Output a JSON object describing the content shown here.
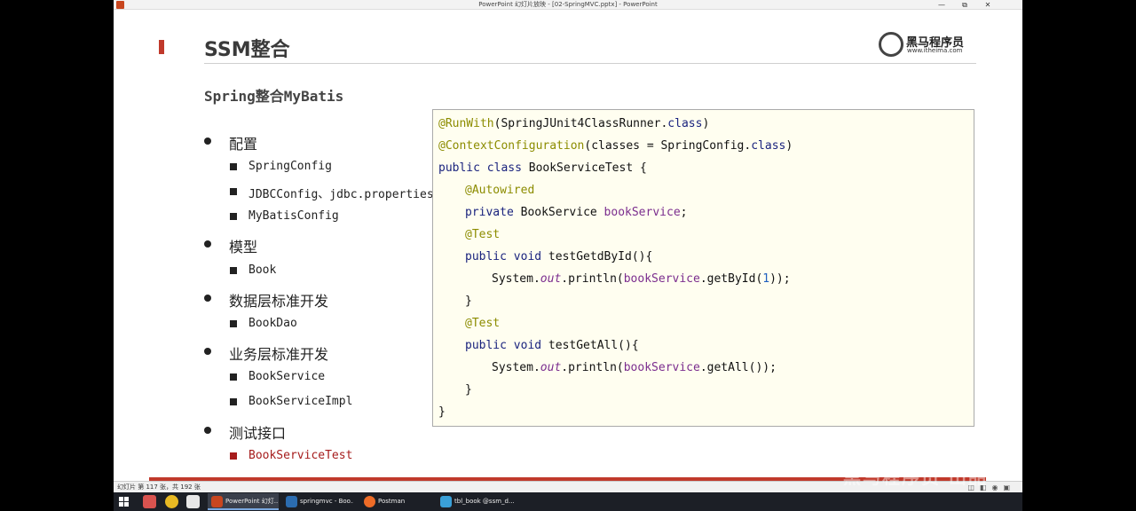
{
  "window": {
    "title": "PowerPoint 幻灯片放映 - [02-SpringMVC.pptx] - PowerPoint",
    "min_label": "—",
    "max_label": "⧉",
    "close_label": "✕"
  },
  "slide": {
    "title": "SSM整合",
    "logo": {
      "brand": "黑马程序员",
      "url": "www.itheima.com"
    },
    "subtitle": "Spring整合MyBatis",
    "outline": [
      {
        "label": "配置",
        "children": [
          "SpringConfig",
          "JDBCConfig、jdbc.properties",
          "MyBatisConfig"
        ]
      },
      {
        "label": "模型",
        "children": [
          "Book"
        ]
      },
      {
        "label": "数据层标准开发",
        "children": [
          "BookDao"
        ]
      },
      {
        "label": "业务层标准开发",
        "children": [
          "BookService",
          "BookServiceImpl"
        ]
      },
      {
        "label": "测试接口",
        "children": [
          "BookServiceTest"
        ]
      }
    ],
    "code": {
      "l1_ann": "@RunWith",
      "l1_rest": "(SpringJUnit4ClassRunner.",
      "l1_kw": "class",
      "l1_end": ")",
      "l2_ann": "@ContextConfiguration",
      "l2_rest": "(classes = SpringConfig.",
      "l2_kw": "class",
      "l2_end": ")",
      "l3_kw": "public class",
      "l3_rest": " BookServiceTest {",
      "l4_ann": "@Autowired",
      "l5_kw": "private",
      "l5_rest": " BookService ",
      "l5_fld": "bookService",
      "l5_end": ";",
      "l6_ann": "@Test",
      "l7_kw": "public void",
      "l7_rest": " testGetdById(){",
      "l8_pre": "System.",
      "l8_out": "out",
      "l8_mid": ".println(",
      "l8_fld": "bookService",
      "l8_call": ".getById(",
      "l8_num": "1",
      "l8_end": "));",
      "l9": "}",
      "l10_ann": "@Test",
      "l11_kw": "public void",
      "l11_rest": " testGetAll(){",
      "l12_pre": "System.",
      "l12_out": "out",
      "l12_mid": ".println(",
      "l12_fld": "bookService",
      "l12_end": ".getAll());",
      "l13": "}",
      "l14": "}"
    }
  },
  "statusbar": {
    "text": "幻灯片 第 117 张，共 192 张"
  },
  "watermark": "黑马程序员 出品",
  "taskbar": {
    "items": [
      {
        "label": "PowerPoint 幻灯...",
        "color": "#c8461f"
      },
      {
        "label": "springmvc - Boo...",
        "color": "#2b6cb0"
      },
      {
        "label": "Postman",
        "color": "#ef6c27"
      },
      {
        "label": "tbl_book @ssm_d...",
        "color": "#3aa0d8"
      }
    ]
  },
  "colors": {
    "accent": "#c0392b",
    "code_bg": "#fffef0",
    "annotation": "#8c8c00",
    "keyword": "#1a237e",
    "field": "#7b2d8e"
  }
}
